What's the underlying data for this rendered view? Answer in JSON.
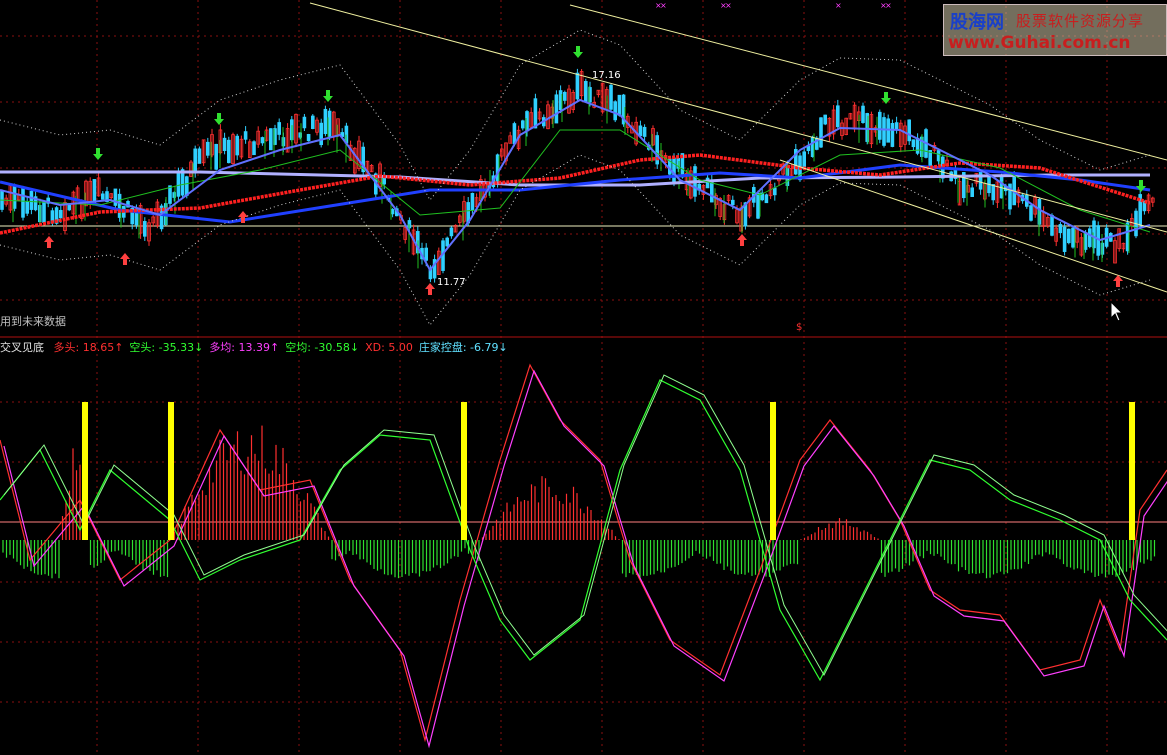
{
  "window": {
    "note": "用到未来数据"
  },
  "watermark": {
    "logo": "股海网",
    "slogan": "股票软件资源分享",
    "url": "www.Guhai.com.cn"
  },
  "price_panel": {
    "high_label": "17.16",
    "low_label": "11.77",
    "marker": "$"
  },
  "indicator_legend": {
    "name": "交叉见底",
    "items": [
      {
        "label": "多头",
        "value": "18.65",
        "arrow": "↑",
        "color": "#ff3030"
      },
      {
        "label": "空头",
        "value": "-35.33",
        "arrow": "↓",
        "color": "#30ff30"
      },
      {
        "label": "多均",
        "value": "13.39",
        "arrow": "↑",
        "color": "#ff40ff"
      },
      {
        "label": "空均",
        "value": "-30.58",
        "arrow": "↓",
        "color": "#30ff30"
      },
      {
        "label": "XD",
        "value": "5.00",
        "arrow": "",
        "color": "#ff3030"
      },
      {
        "label": "庄家控盘",
        "value": "-6.79",
        "arrow": "↓",
        "color": "#60e0ff"
      }
    ]
  },
  "chart_data": [
    {
      "type": "line",
      "title": "",
      "description": "candlestick price chart with moving averages and channel lines",
      "y_range": [
        11.0,
        18.5
      ],
      "series": [
        {
          "name": "MA-red",
          "color": "#ff2020"
        },
        {
          "name": "MA-blue",
          "color": "#2040ff"
        },
        {
          "name": "MA-lavender",
          "color": "#a8a8ff"
        },
        {
          "name": "MA-green",
          "color": "#20c020"
        }
      ],
      "annotations": [
        {
          "text": "17.16",
          "kind": "high"
        },
        {
          "text": "11.77",
          "kind": "low"
        }
      ],
      "up_arrow_count": 6,
      "down_arrow_count": 6
    },
    {
      "type": "line",
      "title": "交叉见底",
      "series": [
        {
          "name": "多头",
          "last": 18.65,
          "color": "#ff3030"
        },
        {
          "name": "空头",
          "last": -35.33,
          "color": "#30ff30"
        },
        {
          "name": "多均",
          "last": 13.39,
          "color": "#ff40ff"
        },
        {
          "name": "空均",
          "last": -30.58,
          "color": "#30ff30"
        },
        {
          "name": "XD",
          "last": 5.0,
          "color": "#ff3030"
        },
        {
          "name": "庄家控盘",
          "last": -6.79,
          "color": "#60e0ff"
        }
      ],
      "signal_bar_count": 5,
      "signal_color": "#ffff00"
    }
  ]
}
